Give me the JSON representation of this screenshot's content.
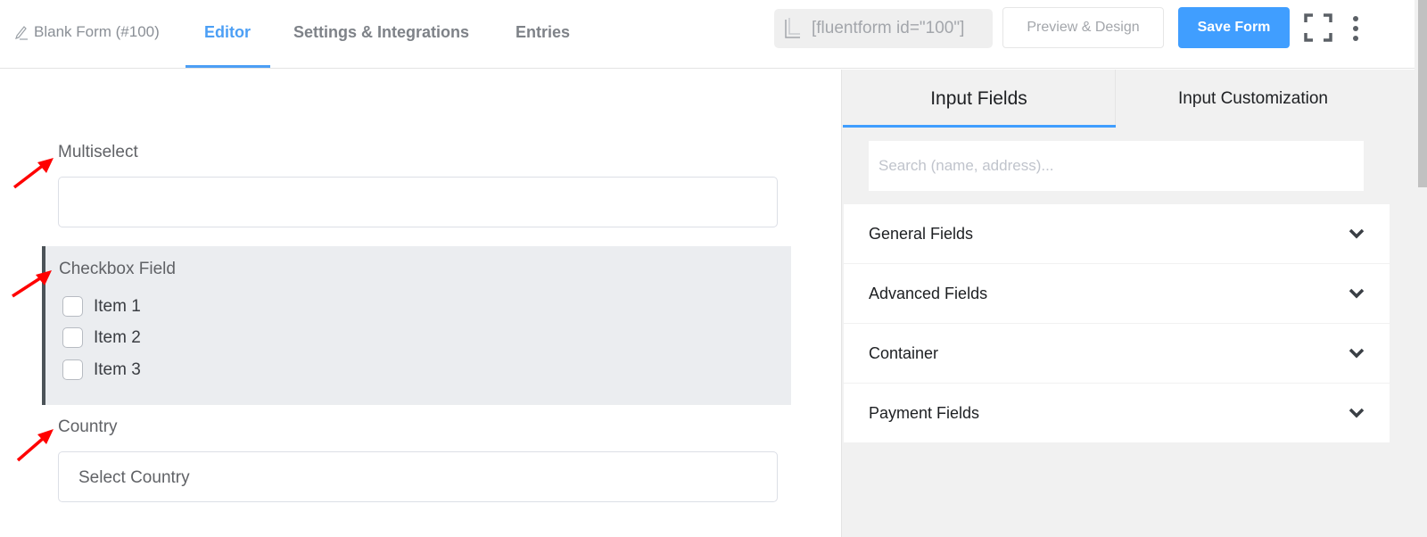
{
  "header": {
    "form_title": "Blank Form (#100)",
    "tabs": [
      {
        "label": "Editor",
        "active": true
      },
      {
        "label": "Settings & Integrations",
        "active": false
      },
      {
        "label": "Entries",
        "active": false
      }
    ],
    "shortcode": "[fluentform id=\"100\"]",
    "preview_label": "Preview & Design",
    "save_label": "Save Form",
    "accent_color": "#409eff"
  },
  "editor": {
    "fields": [
      {
        "type": "multiselect",
        "label": "Multiselect",
        "value": ""
      },
      {
        "type": "checkbox",
        "label": "Checkbox Field",
        "options": [
          "Item 1",
          "Item 2",
          "Item 3"
        ],
        "selected": false
      },
      {
        "type": "select",
        "label": "Country",
        "placeholder": "Select Country"
      }
    ],
    "annotation_color": "#ff0000"
  },
  "sidebar": {
    "tabs": [
      {
        "label": "Input Fields",
        "active": true
      },
      {
        "label": "Input Customization",
        "active": false
      }
    ],
    "search_placeholder": "Search (name, address)...",
    "sections": [
      {
        "label": "General Fields"
      },
      {
        "label": "Advanced Fields"
      },
      {
        "label": "Container"
      },
      {
        "label": "Payment Fields"
      }
    ]
  }
}
